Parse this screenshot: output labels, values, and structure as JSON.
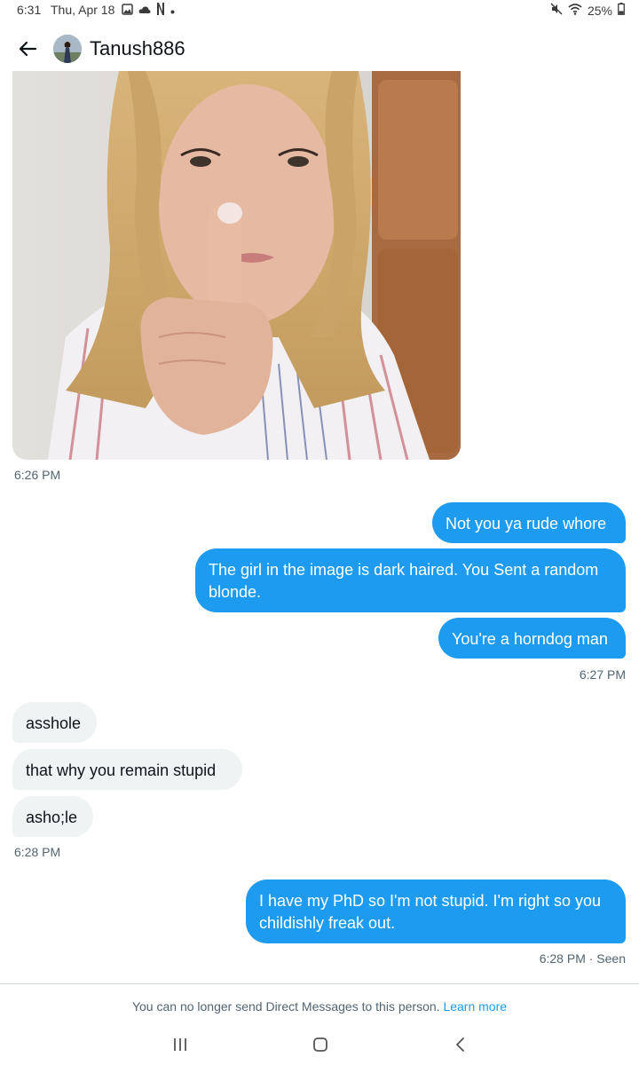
{
  "status_bar": {
    "time": "6:31",
    "date": "Thu, Apr 18",
    "icons": [
      "gallery-icon",
      "cloud-icon",
      "netflix-icon",
      "dot-icon"
    ],
    "right_icons": [
      "mute-icon",
      "wifi-icon"
    ],
    "battery_text": "25%"
  },
  "header": {
    "username": "Tanush886"
  },
  "messages": {
    "image_timestamp": "6:26 PM",
    "out1": "Not you ya rude whore",
    "out2": "The girl in the image is dark haired. You Sent a random blonde.",
    "out3": "You're a horndog man",
    "out_timestamp": "6:27 PM",
    "in1": "asshole",
    "in2": "that why you remain stupid",
    "in3": "asho;le",
    "in_timestamp": "6:28 PM",
    "out4": "I have my PhD so I'm not stupid. I'm right so you childishly freak out.",
    "out4_timestamp": "6:28 PM · Seen"
  },
  "footer": {
    "notice_text": "You can no longer send Direct Messages to this person.",
    "learn_more": "Learn more"
  },
  "nav_bar": [
    "recents-icon",
    "home-icon",
    "back-icon"
  ],
  "colors": {
    "accent": "#1d9bf0",
    "incoming_bubble": "#eff3f4",
    "secondary_text": "#536471"
  }
}
